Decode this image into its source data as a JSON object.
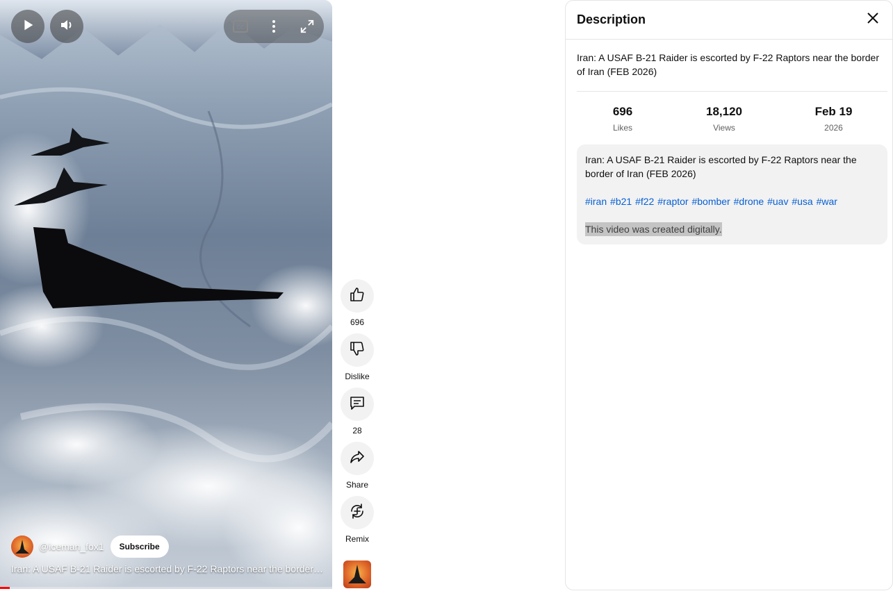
{
  "player": {
    "play_icon": "play-icon",
    "volume_icon": "volume-icon",
    "captions_icon": "cc-icon",
    "captions_label": "CC",
    "more_icon": "more-vert-icon",
    "fullscreen_icon": "fullscreen-icon",
    "channel_name": "@iceman_fox1",
    "subscribe_label": "Subscribe",
    "caption": "Iran: A USAF B-21 Raider is escorted by F-22 Raptors near the border o...",
    "progress_fraction": 0.03,
    "accent_color": "#ff0000"
  },
  "actions": {
    "like": {
      "icon": "thumbs-up-icon",
      "label": "696"
    },
    "dislike": {
      "icon": "thumbs-down-icon",
      "label": "Dislike"
    },
    "comments": {
      "icon": "comment-icon",
      "label": "28"
    },
    "share": {
      "icon": "share-icon",
      "label": "Share"
    },
    "remix": {
      "icon": "remix-icon",
      "label": "Remix"
    }
  },
  "description_panel": {
    "title": "Description",
    "close_icon": "close-icon",
    "summary": "Iran: A USAF B-21 Raider is escorted by F-22 Raptors near the border of Iran (FEB 2026)",
    "stats": [
      {
        "value": "696",
        "label": "Likes"
      },
      {
        "value": "18,120",
        "label": "Views"
      },
      {
        "value": "Feb 19",
        "label": "2026"
      }
    ],
    "body_text": "Iran: A USAF B-21 Raider is escorted by F-22 Raptors near the border of Iran (FEB 2026)",
    "hashtags": [
      "#iran",
      "#b21",
      "#f22",
      "#raptor",
      "#bomber",
      "#drone",
      "#uav",
      "#usa",
      "#war"
    ],
    "disclaimer": "This video was created digitally.",
    "link_color": "#065fd4"
  }
}
